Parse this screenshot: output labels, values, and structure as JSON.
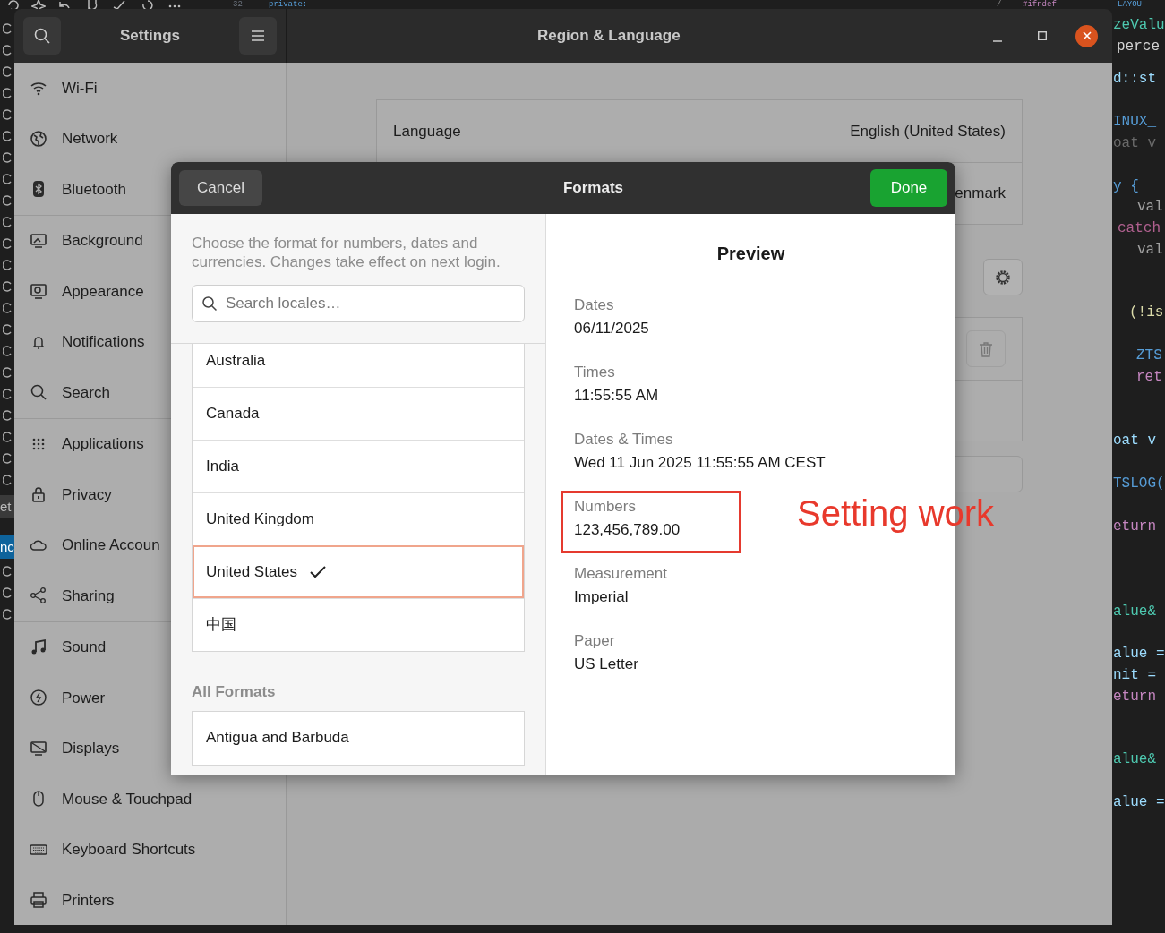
{
  "editor": {
    "line_number": "32",
    "top_code": [
      {
        "text": "private:"
      },
      {
        "text": "/"
      },
      {
        "text": "#ifndef"
      },
      {
        "text": "LAYOU"
      }
    ],
    "gutter_texts": [
      {
        "text": "et",
        "selected": false
      },
      {
        "text": "nc",
        "selected": true
      }
    ],
    "code_lines": [
      {
        "text": "zeValu",
        "color": "#4ec9b0"
      },
      {
        "text": "perce",
        "color": "#d4d4d4"
      },
      {
        "text": "d::st",
        "color": "#9cdcfe"
      },
      {
        "text": "INUX_",
        "color": "#569cd6"
      },
      {
        "text": "oat v",
        "color": "#6a6a6a"
      },
      {
        "text": "y {",
        "color": "#569cd6"
      },
      {
        "text": "val",
        "color": "#a0a0a0"
      },
      {
        "text": "catch",
        "color": "#b0608f"
      },
      {
        "text": "val",
        "color": "#a0a0a0"
      },
      {
        "text": "(!is",
        "color": "#dcdcaa"
      },
      {
        "text": "ZTS",
        "color": "#569cd6"
      },
      {
        "text": "ret",
        "color": "#c586c0"
      },
      {
        "text": "oat v",
        "color": "#9cdcfe"
      },
      {
        "text": "TSLOG(",
        "color": "#569cd6"
      },
      {
        "text": "eturn",
        "color": "#c586c0"
      },
      {
        "text": "alue&",
        "color": "#4ec9b0"
      },
      {
        "text": "alue =",
        "color": "#9cdcfe"
      },
      {
        "text": "nit =",
        "color": "#9cdcfe"
      },
      {
        "text": "eturn",
        "color": "#c586c0"
      },
      {
        "text": "alue&",
        "color": "#4ec9b0"
      },
      {
        "text": "alue =",
        "color": "#9cdcfe"
      }
    ]
  },
  "settings": {
    "title": "Settings",
    "panel_title": "Region & Language",
    "sidebar_groups": [
      [
        {
          "label": "Wi-Fi"
        },
        {
          "label": "Network"
        },
        {
          "label": "Bluetooth"
        }
      ],
      [
        {
          "label": "Background"
        },
        {
          "label": "Appearance"
        },
        {
          "label": "Notifications"
        },
        {
          "label": "Search"
        }
      ],
      [
        {
          "label": "Applications"
        },
        {
          "label": "Privacy"
        },
        {
          "label": "Online Accoun"
        },
        {
          "label": "Sharing"
        }
      ],
      [
        {
          "label": "Sound"
        },
        {
          "label": "Power"
        },
        {
          "label": "Displays"
        },
        {
          "label": "Mouse & Touchpad"
        },
        {
          "label": "Keyboard Shortcuts"
        },
        {
          "label": "Printers"
        }
      ]
    ],
    "language_rows": [
      {
        "label": "Language",
        "value": "English (United States)"
      },
      {
        "value": "enmark"
      }
    ]
  },
  "dialog": {
    "title": "Formats",
    "cancel": "Cancel",
    "done": "Done",
    "description": "Choose the format for numbers, dates and currencies. Changes take effect on next login.",
    "search": {
      "placeholder": "Search locales…"
    },
    "common_locales": [
      {
        "label": "Australia",
        "selected": false
      },
      {
        "label": "Canada",
        "selected": false
      },
      {
        "label": "India",
        "selected": false
      },
      {
        "label": "United Kingdom",
        "selected": false
      },
      {
        "label": "United States",
        "selected": true
      },
      {
        "label": "中国",
        "selected": false
      }
    ],
    "section_title": "All Formats",
    "all_locales": [
      {
        "label": "Antigua and Barbuda",
        "selected": false
      }
    ],
    "preview": {
      "title": "Preview",
      "items": [
        {
          "label": "Dates",
          "value": "06/11/2025",
          "highlighted": false
        },
        {
          "label": "Times",
          "value": "11:55:55 AM",
          "highlighted": false
        },
        {
          "label": "Dates & Times",
          "value": "Wed 11 Jun 2025 11:55:55 AM CEST",
          "highlighted": false
        },
        {
          "label": "Numbers",
          "value": "123,456,789.00",
          "highlighted": true
        },
        {
          "label": "Measurement",
          "value": "Imperial",
          "highlighted": false
        },
        {
          "label": "Paper",
          "value": "US Letter",
          "highlighted": false
        }
      ]
    }
  },
  "annotation": {
    "text": "Setting work"
  }
}
